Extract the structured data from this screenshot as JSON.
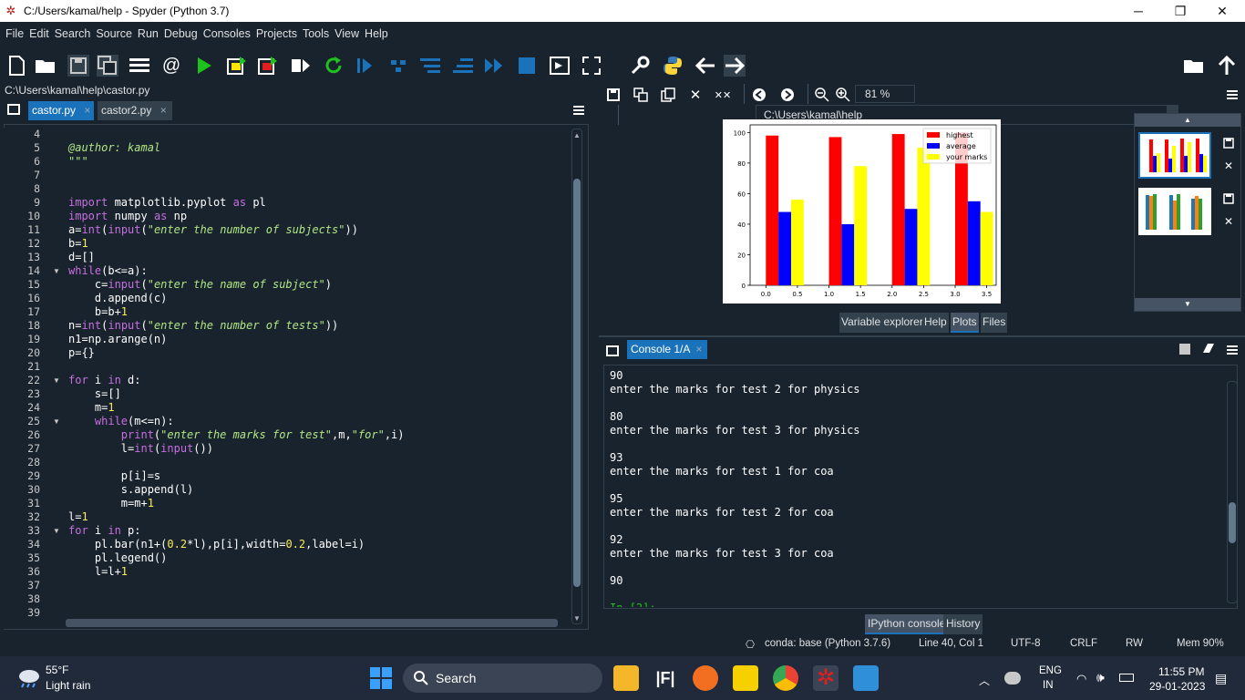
{
  "window": {
    "title": "C:/Users/kamal/help - Spyder (Python 3.7)",
    "controls": {
      "minimize": "─",
      "maximize": "❐",
      "close": "✕"
    }
  },
  "menu": [
    "File",
    "Edit",
    "Search",
    "Source",
    "Run",
    "Debug",
    "Consoles",
    "Projects",
    "Tools",
    "View",
    "Help"
  ],
  "toolbar": {
    "working_dir": "C:\\Users\\kamal\\help"
  },
  "editor": {
    "path": "C:\\Users\\kamal\\help\\castor.py",
    "tabs": [
      {
        "label": "castor.py",
        "close": "×",
        "active": true
      },
      {
        "label": "castor2.py",
        "close": "×",
        "active": false
      }
    ],
    "line_numbers": [
      "4",
      "5",
      "6",
      "7",
      "8",
      "9",
      "10",
      "11",
      "12",
      "13",
      "14",
      "15",
      "16",
      "17",
      "18",
      "19",
      "20",
      "21",
      "22",
      "23",
      "24",
      "25",
      "26",
      "27",
      "28",
      "29",
      "30",
      "31",
      "32",
      "33",
      "34",
      "35",
      "36",
      "37",
      "38",
      "39"
    ]
  },
  "plots": {
    "zoom": "81 %",
    "pane_tabs": [
      "Variable explorer",
      "Help",
      "Plots",
      "Files"
    ],
    "active_tab": "Plots"
  },
  "chart_data": {
    "type": "bar",
    "x": [
      0,
      1,
      2,
      3
    ],
    "xticks": [
      "0.0",
      "0.5",
      "1.0",
      "1.5",
      "2.0",
      "2.5",
      "3.0",
      "3.5"
    ],
    "yticks": [
      "0",
      "20",
      "40",
      "60",
      "80",
      "100"
    ],
    "ylim": [
      0,
      105
    ],
    "series": [
      {
        "name": "highest",
        "color": "#ff0000",
        "values": [
          98,
          97,
          99,
          100
        ]
      },
      {
        "name": "average",
        "color": "#0000ff",
        "values": [
          48,
          40,
          50,
          55
        ]
      },
      {
        "name": "your marks",
        "color": "#ffff00",
        "values": [
          56,
          78,
          90,
          48
        ]
      }
    ],
    "legend": "top-right"
  },
  "console": {
    "tab": "Console 1/A",
    "lines": [
      "90",
      "enter the marks for test 2 for physics",
      "",
      "80",
      "enter the marks for test 3 for physics",
      "",
      "93",
      "enter the marks for test 1 for coa",
      "",
      "95",
      "enter the marks for test 2 for coa",
      "",
      "92",
      "enter the marks for test 3 for coa",
      "",
      "90"
    ],
    "bottom_tabs": [
      "IPython console",
      "History"
    ],
    "active_bottom_tab": "IPython console"
  },
  "status": {
    "env": "conda: base (Python 3.7.6)",
    "position": "Line 40, Col 1",
    "encoding": "UTF-8",
    "eol": "CRLF",
    "rw": "RW",
    "mem": "Mem 90%"
  },
  "taskbar": {
    "weather_temp": "55°F",
    "weather_desc": "Light rain",
    "search": "Search",
    "lang1": "ENG",
    "lang2": "IN",
    "time": "11:55 PM",
    "date": "29-01-2023"
  }
}
